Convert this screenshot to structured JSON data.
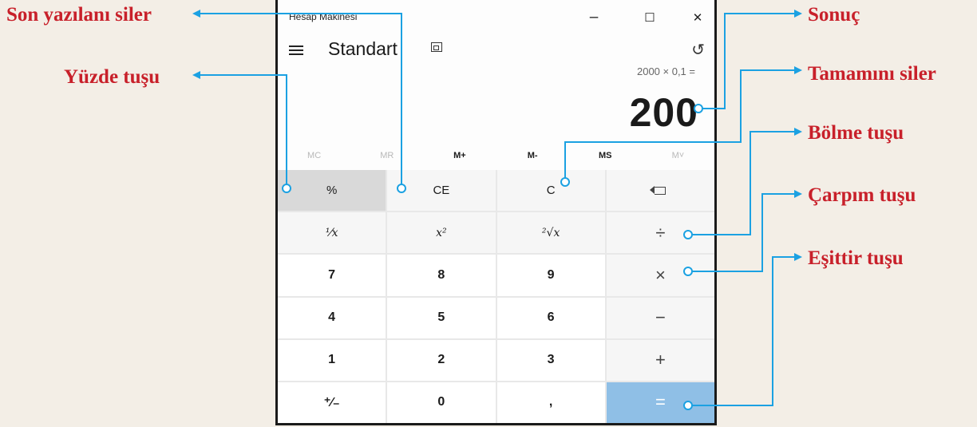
{
  "window": {
    "title": "Hesap Makinesi",
    "minimize_label": "–",
    "maximize_label": "☐",
    "close_label": "✕"
  },
  "header": {
    "mode": "Standart",
    "keep_on_top_icon": "keep-on-top-icon",
    "history_icon": "history-icon",
    "history_glyph": "↺"
  },
  "display": {
    "expression": "2000 × 0,1 =",
    "result": "200"
  },
  "memory": {
    "mc": "MC",
    "mr": "MR",
    "mplus": "M+",
    "mminus": "M-",
    "ms": "MS",
    "mlist": "M˅"
  },
  "keys": {
    "percent": "%",
    "ce": "CE",
    "c": "C",
    "reciprocal": "⅟x",
    "square": "x²",
    "sqrt": "²√x",
    "divide": "÷",
    "seven": "7",
    "eight": "8",
    "nine": "9",
    "multiply": "×",
    "four": "4",
    "five": "5",
    "six": "6",
    "minus": "−",
    "one": "1",
    "two": "2",
    "three": "3",
    "plus": "+",
    "negate": "⁺∕₋",
    "zero": "0",
    "decimal": ",",
    "equals": "="
  },
  "annotations": {
    "backspace": "Son yazılanı siler",
    "percent": "Yüzde tuşu",
    "result": "Sonuç",
    "clear_all": "Tamamını siler",
    "divide": "Bölme tuşu",
    "multiply": "Çarpım tuşu",
    "equals": "Eşittir tuşu"
  },
  "colors": {
    "annotation_text": "#c8202a",
    "leader_line": "#1ba1e2",
    "equals_key": "#8fbfe6",
    "background": "#f3eee6"
  }
}
